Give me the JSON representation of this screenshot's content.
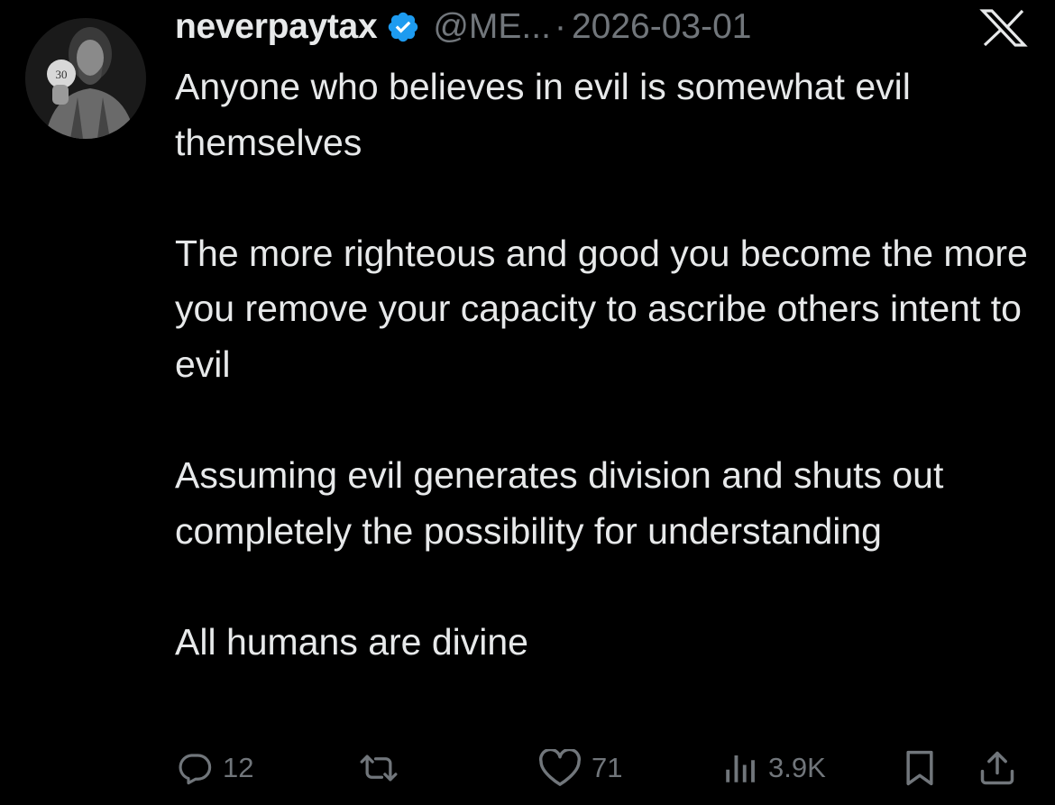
{
  "author": {
    "display_name": "neverpaytax",
    "handle": "@ME...",
    "separator": "·",
    "date": "2026-03-01",
    "verified": true,
    "avatar": {
      "icon": "avatar-portrait",
      "inset_text": "30"
    }
  },
  "platform_logo": "x-logo-icon",
  "tweet": {
    "paragraphs": [
      "Anyone who believes in evil is somewhat evil themselves",
      "The more righteous and good you become the more you remove your capacity to ascribe others intent to evil",
      "Assuming evil generates division and shuts out completely the possibility for understanding",
      "All humans are divine"
    ]
  },
  "actions": {
    "reply": {
      "icon": "reply-icon",
      "count": "12"
    },
    "retweet": {
      "icon": "retweet-icon",
      "count": ""
    },
    "like": {
      "icon": "heart-icon",
      "count": "71"
    },
    "views": {
      "icon": "views-icon",
      "count": "3.9K"
    },
    "bookmark": {
      "icon": "bookmark-icon"
    },
    "share": {
      "icon": "share-icon"
    }
  },
  "colors": {
    "background": "#000000",
    "text": "#e7e9ea",
    "secondary_text": "#71767b",
    "verified_badge": "#1d9bf0"
  }
}
